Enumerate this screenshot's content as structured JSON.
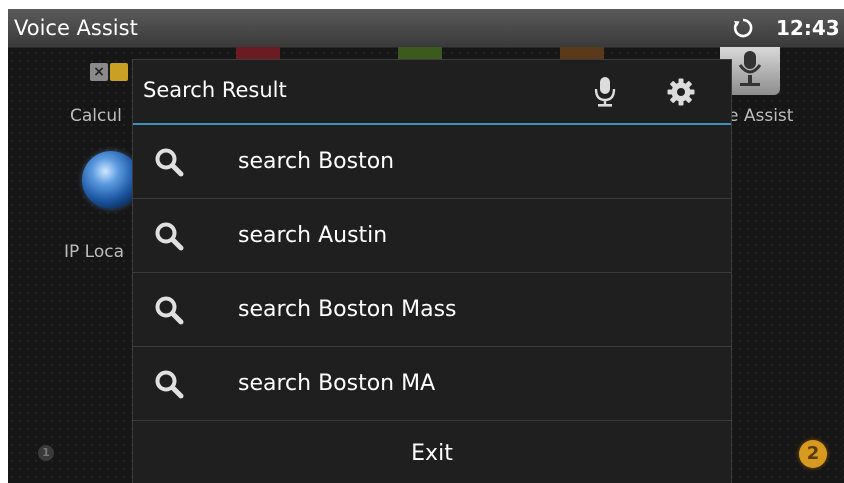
{
  "status_bar": {
    "title": "Voice Assist",
    "sync_icon": "sync-icon",
    "time": "12:43"
  },
  "background": {
    "labels": [
      "Calcul",
      "IP Loca",
      "e Assist"
    ],
    "page_indicators": [
      "1",
      "2"
    ],
    "active_page_color": "#d79a1e"
  },
  "dialog": {
    "title": "Search Result",
    "mic_icon": "microphone-icon",
    "settings_icon": "gear-icon",
    "accent_color": "#3d8fb8",
    "results": [
      {
        "icon": "search-icon",
        "text": "search Boston"
      },
      {
        "icon": "search-icon",
        "text": "search Austin"
      },
      {
        "icon": "search-icon",
        "text": "search Boston Mass"
      },
      {
        "icon": "search-icon",
        "text": "search Boston MA"
      }
    ],
    "exit_label": "Exit"
  }
}
